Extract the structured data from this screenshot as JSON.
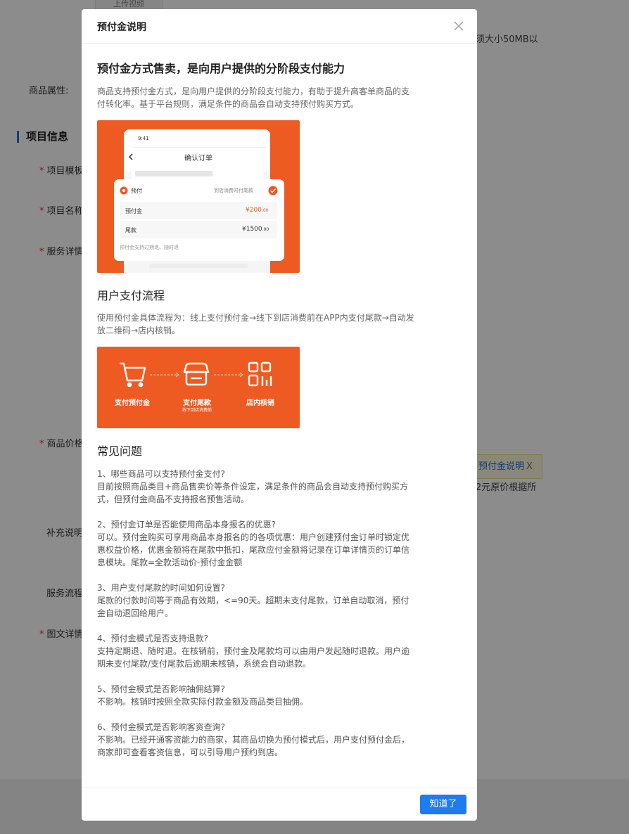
{
  "background": {
    "upload_button": "上传视频",
    "size_hint": "须大小50MB以",
    "labels": {
      "product_attr": "商品属性:",
      "project_template": "项目模板",
      "project_name": "项目名称",
      "service_detail": "服务详情",
      "price": "商品价格",
      "supplement": "补充说明",
      "service_flow": "服务流程",
      "rich_detail": "图文详情"
    },
    "required_mark": "*",
    "section_title": "项目信息",
    "tag_label": "预付金说明",
    "tag_close": "X",
    "price_hint": "2元原价根据所"
  },
  "modal": {
    "title": "预付金说明",
    "close_icon": "close-icon",
    "heading": "预付金方式售卖，是向用户提供的分阶段支付能力",
    "intro": "商品支持预付金方式，是向用户提供的分阶段支付能力，有助于提升高客单商品的支付转化率。基于平台规则，满足条件的商品会自动支持预付购买方式。",
    "phone_mock": {
      "time": "9:41",
      "screen_title": "确认订单",
      "option_label": "预付",
      "option_right": "到店消费时付尾款",
      "row1_label": "预付金",
      "row1_value": "¥200",
      "row1_decimal": ".00",
      "row2_label": "尾款",
      "row2_value": "¥1500",
      "row2_decimal": ".00",
      "note": "预付金支持过期退、随时退"
    },
    "flow_heading": "用户支付流程",
    "flow_desc": "使用预付金具体流程为：线上支付预付金→线下到店消费前在APP内支付尾款→自动发放二维码→店内核销。",
    "flow_steps": [
      {
        "label": "支付预付金",
        "sub": ""
      },
      {
        "label": "支付尾款",
        "sub": "线下到店消费前"
      },
      {
        "label": "店内核销",
        "sub": ""
      }
    ],
    "faq_heading": "常见问题",
    "faq": [
      {
        "q": "1、哪些商品可以支持预付金支付?",
        "a": "目前按照商品类目+商品售卖价等条件设定，满足条件的商品会自动支持预付购买方式，但预付金商品不支持报名预售活动。"
      },
      {
        "q": "2、预付金订单是否能使用商品本身报名的优惠?",
        "a": "可以。预付金购买可享用商品本身报名的的各项优惠：用户创建预付金订单时锁定优惠权益价格，优惠金额将在尾款中抵扣，尾款应付金额将记录在订单详情页的订单信息模块。尾款=全款活动价-预付金金额"
      },
      {
        "q": "3、用户支付尾款的时间如何设置?",
        "a": "尾款的付款时间等于商品有效期，<=90天。超期未支付尾款，订单自动取消，预付金自动退回给用户。"
      },
      {
        "q": "4、预付金模式是否支持退款?",
        "a": "支持定期退、随时退。在核销前，预付金及尾款均可以由用户发起随时退款。用户逾期未支付尾款/支付尾款后逾期未核销，系统会自动退款。"
      },
      {
        "q": "5、预付金模式是否影响抽佣结算?",
        "a": "不影响。核销时按照全款实际付款金额及商品类目抽佣。"
      },
      {
        "q": "6、预付金模式是否影响客资查询?",
        "a": "不影响。已经开通客资能力的商家，其商品切换为预付模式后，用户支付预付金后，商家即可查看客资信息，可以引导用户预约到店。"
      }
    ],
    "ok_button": "知道了"
  },
  "colors": {
    "accent_orange": "#ed5b22",
    "primary_blue": "#1e7bf0",
    "price_red": "#f0541e"
  }
}
